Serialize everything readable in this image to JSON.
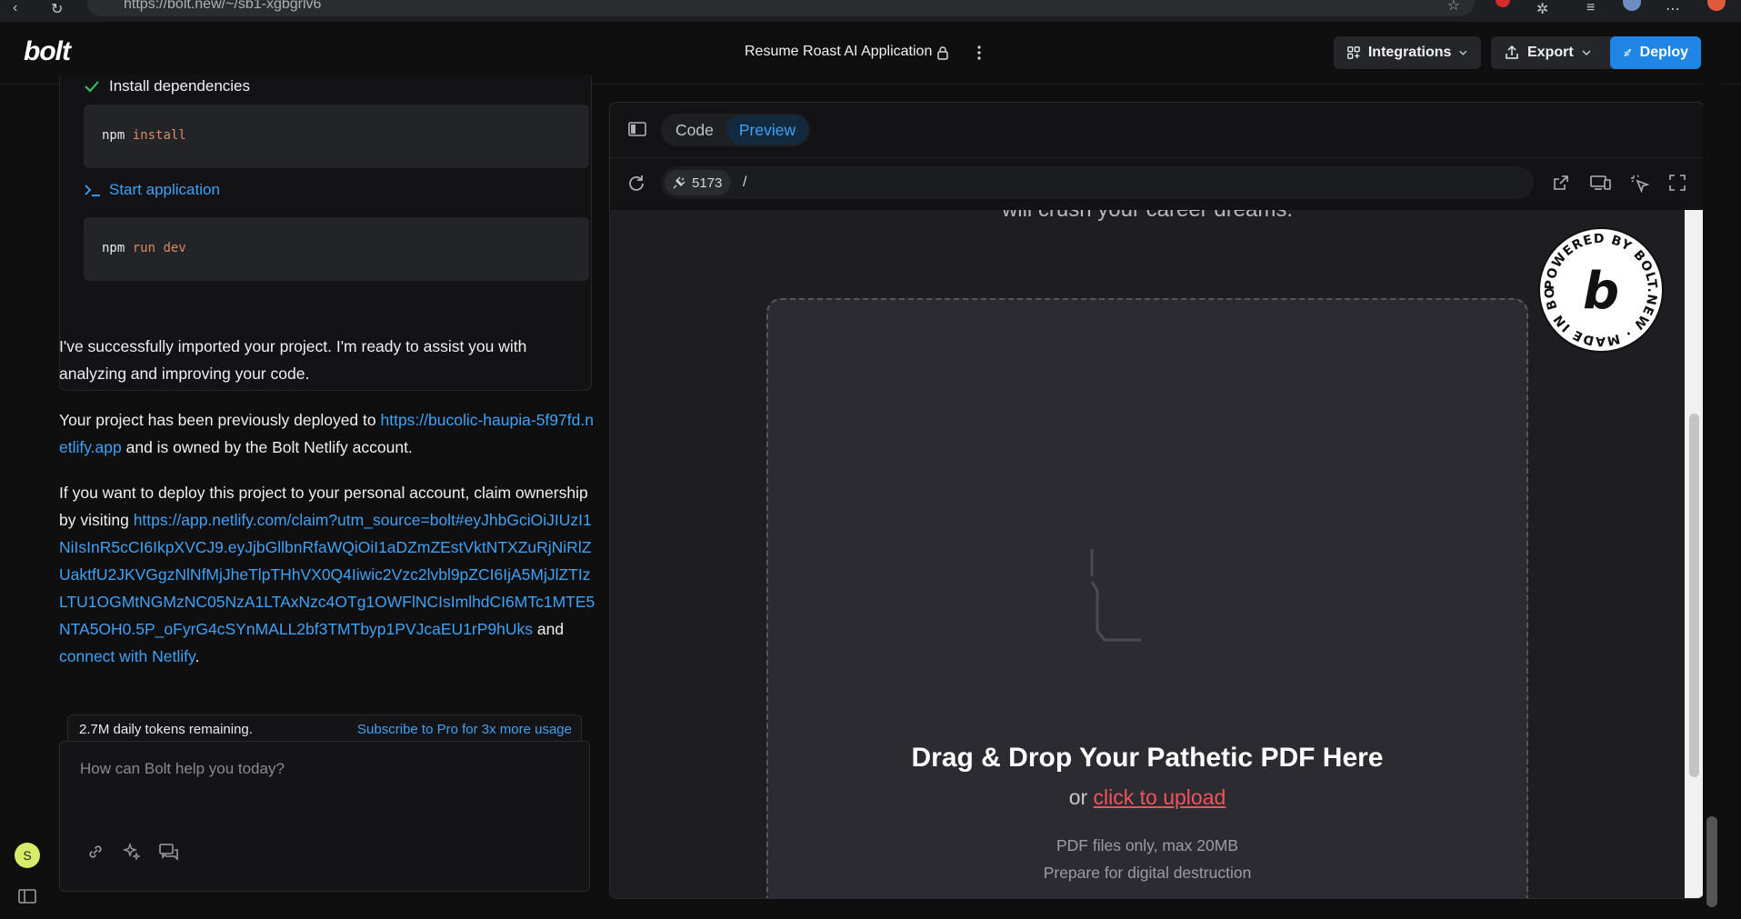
{
  "browser": {
    "url": "https://bolt.new/~/sb1-xgbgrlv6"
  },
  "header": {
    "logo": "bolt",
    "project_title": "Resume Roast AI Application",
    "integrations_label": "Integrations",
    "export_label": "Export",
    "deploy_label": "Deploy"
  },
  "chat": {
    "steps": [
      {
        "label": "Install dependencies",
        "command": "npm",
        "args": "install"
      },
      {
        "label": "Start application",
        "command": "npm",
        "args": "run dev"
      }
    ],
    "msg1": "I've successfully imported your project. I'm ready to assist you with analyzing and improving your code.",
    "msg2": {
      "pre": "Your project has been previously deployed to ",
      "link": "https://bucolic-haupia-5f97fd.netlify.app",
      "post": " and is owned by the Bolt Netlify account."
    },
    "msg3": {
      "pre": "If you want to deploy this project to your personal account, claim ownership by visiting ",
      "link": "https://app.netlify.com/claim?utm_source=bolt#eyJhbGciOiJIUzI1NiIsInR5cCI6IkpXVCJ9.eyJjbGllbnRfaWQiOiI1aDZmZEstVktNTXZuRjNiRlZUaktfU2JKVGgzNlNfMjJheTlpTHhVX0Q4Iiwic2Vzc2lvbl9pZCI6IjA5MjJlZTIzLTU1OGMtNGMzNC05NzA1LTAxNzc4OTg1OWFlNCIsImlhdCI6MTc1MTE5NTA5OH0.5P_oFyrG4cSYnMALL2bf3TMTbyp1PVJcaEU1rP9hUks",
      "mid": " and ",
      "link2": "connect with Netlify",
      "post": "."
    },
    "tokens_text": "2.7M daily tokens remaining.",
    "subscribe_text": "Subscribe to Pro for 3x more usage",
    "prompt_placeholder": "How can Bolt help you today?",
    "avatar_initial": "S"
  },
  "workbench": {
    "tabs": [
      "Code",
      "Preview"
    ],
    "active_tab": "Preview",
    "port": "5173",
    "path": "/"
  },
  "preview": {
    "hero_tail": "will crush your career dreams.",
    "dropzone_title": "Drag & Drop Your Pathetic PDF Here",
    "dropzone_or": "or ",
    "dropzone_link": "click to upload",
    "note1": "PDF files only, max 20MB",
    "note2": "Prepare for digital destruction",
    "badge_text": "POWERED BY BOLT.NEW · MADE IN BOLT.NEW ·"
  },
  "colors": {
    "accent": "#1f86e6",
    "link": "#3ea2f5",
    "danger": "#f0555a",
    "check": "#35c46b"
  }
}
